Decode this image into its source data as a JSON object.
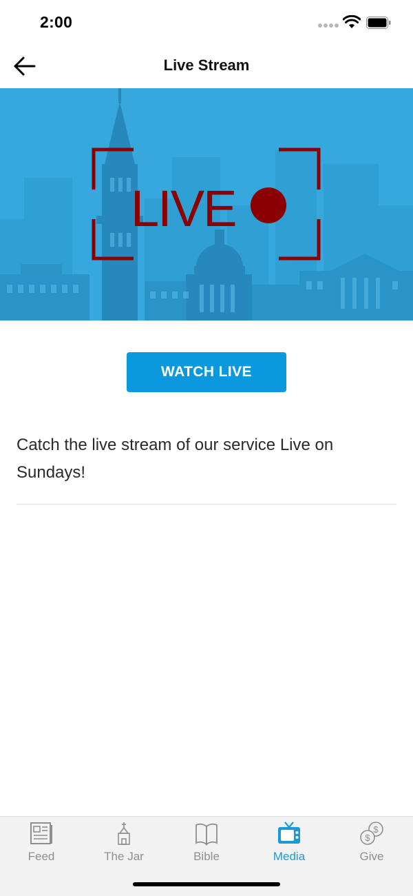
{
  "status_bar": {
    "time": "2:00"
  },
  "header": {
    "title": "Live Stream"
  },
  "banner": {
    "live_text": "LIVE"
  },
  "watch_button": {
    "label": "WATCH LIVE"
  },
  "description": "Catch the live stream of our service Live on Sundays!",
  "tabs": [
    {
      "label": "Feed",
      "icon": "newspaper-icon",
      "active": false
    },
    {
      "label": "The Jar",
      "icon": "church-icon",
      "active": false
    },
    {
      "label": "Bible",
      "icon": "book-icon",
      "active": false
    },
    {
      "label": "Media",
      "icon": "tv-icon",
      "active": true
    },
    {
      "label": "Give",
      "icon": "coins-icon",
      "active": false
    }
  ],
  "colors": {
    "accent": "#1c9ad6",
    "button": "#0b98dd",
    "banner_bg": "#36a8dd",
    "live_red": "#8b0000",
    "tab_inactive": "#8e8e8e"
  }
}
